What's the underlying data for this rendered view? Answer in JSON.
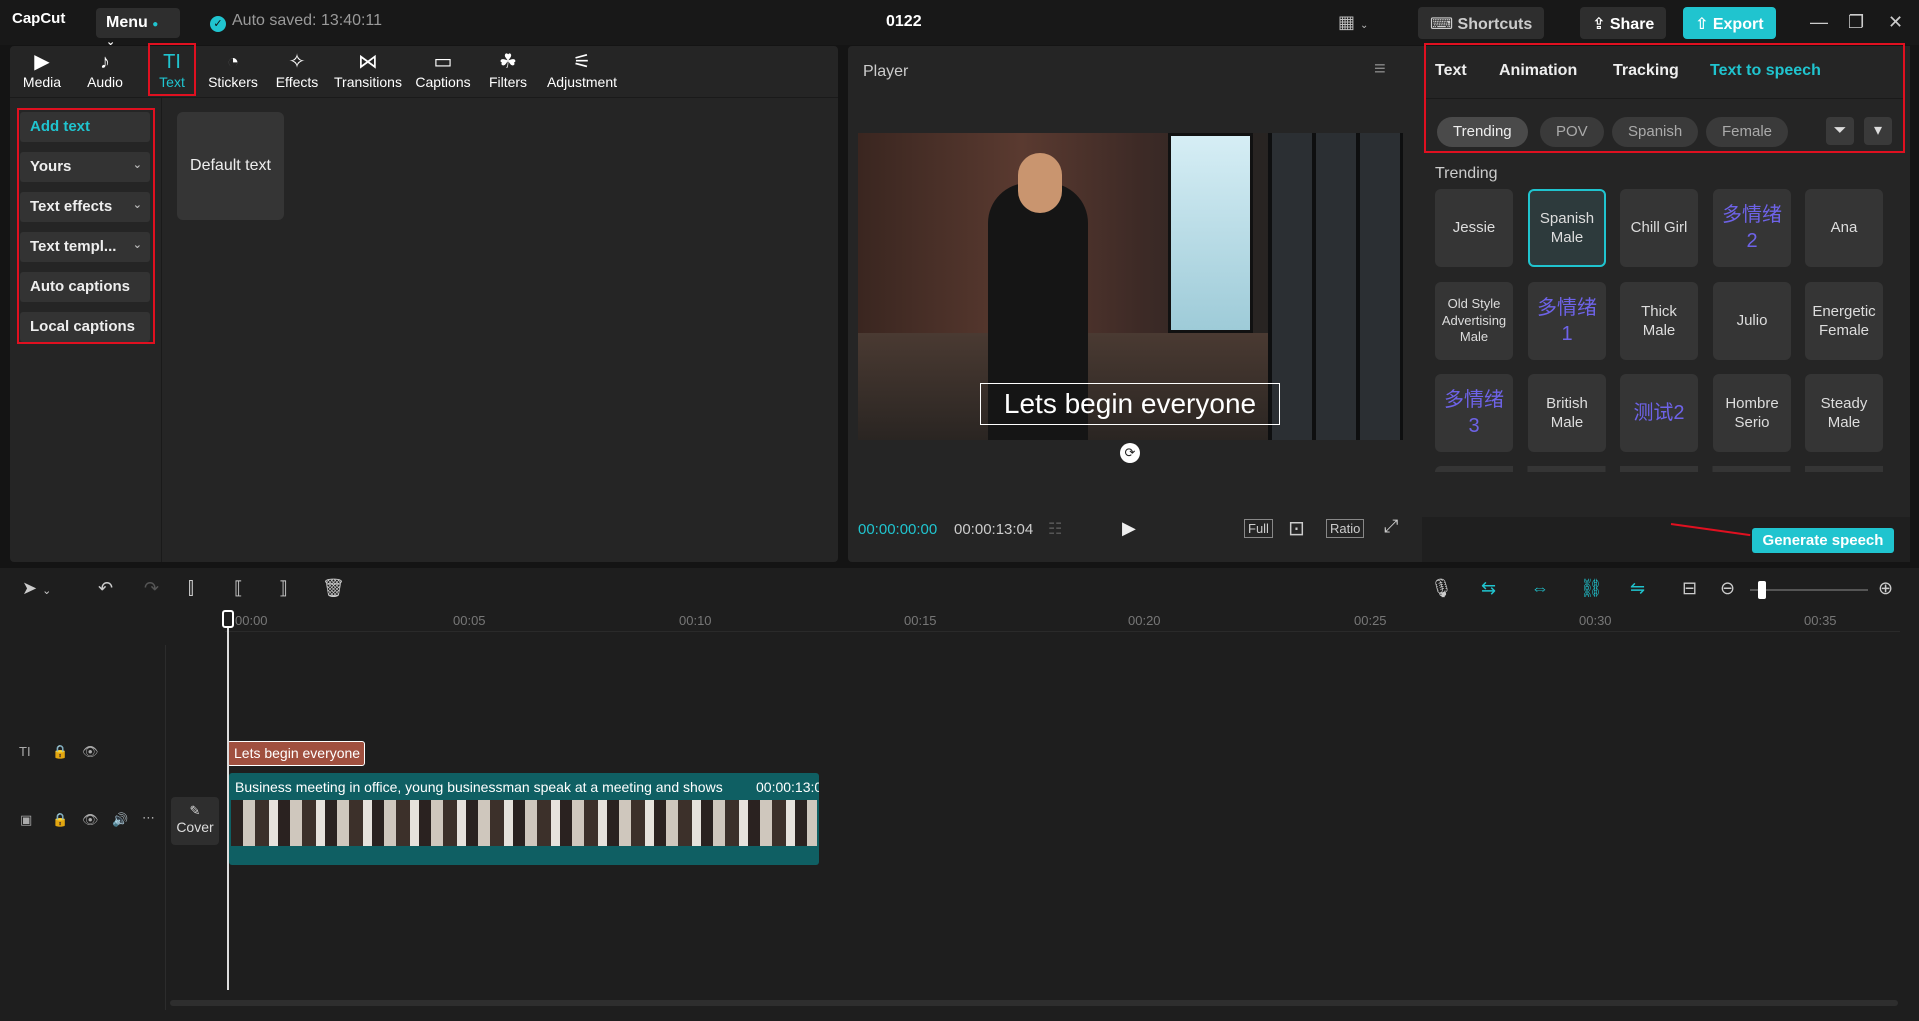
{
  "app": {
    "logo": "CapCut",
    "menu": "Menu",
    "autosave": "Auto saved: 13:40:11",
    "project": "0122"
  },
  "titlebar": {
    "shortcuts": "Shortcuts",
    "share": "Share",
    "export": "Export"
  },
  "media_tabs": [
    {
      "label": "Media",
      "icon": "media-icon"
    },
    {
      "label": "Audio",
      "icon": "audio-icon"
    },
    {
      "label": "Text",
      "icon": "text-icon"
    },
    {
      "label": "Stickers",
      "icon": "stickers-icon"
    },
    {
      "label": "Effects",
      "icon": "effects-icon"
    },
    {
      "label": "Transitions",
      "icon": "transitions-icon"
    },
    {
      "label": "Captions",
      "icon": "captions-icon"
    },
    {
      "label": "Filters",
      "icon": "filters-icon"
    },
    {
      "label": "Adjustment",
      "icon": "adjustment-icon"
    }
  ],
  "sidebar": {
    "items": [
      "Add text",
      "Yours",
      "Text effects",
      "Text templ...",
      "Auto captions",
      "Local captions"
    ]
  },
  "content": {
    "default_text": "Default text"
  },
  "player": {
    "title": "Player",
    "caption": "Lets begin everyone",
    "time_current": "00:00:00:00",
    "time_total": "00:00:13:04",
    "full": "Full",
    "ratio": "Ratio"
  },
  "tts": {
    "tabs": [
      "Text",
      "Animation",
      "Tracking",
      "Text to speech"
    ],
    "filters": [
      "Trending",
      "POV",
      "Spanish",
      "Female"
    ],
    "section": "Trending",
    "voices": [
      "Jessie",
      "Spanish Male",
      "Chill Girl",
      "多情绪2",
      "Ana",
      "Old Style Advertising Male",
      "多情绪1",
      "Thick Male",
      "Julio",
      "Energetic Female",
      "多情绪3",
      "British Male",
      "测试2",
      "Hombre Serio",
      "Steady Male"
    ],
    "generate": "Generate speech"
  },
  "timeline": {
    "ticks": [
      "00:00",
      "00:05",
      "00:10",
      "00:15",
      "00:20",
      "00:25",
      "00:30",
      "00:35"
    ],
    "text_clip": "Lets begin everyone",
    "video_clip": "Business meeting in office, young businessman speak at a meeting and shows",
    "video_duration": "00:00:13:0",
    "cover": "Cover"
  },
  "colors": {
    "accent": "#20c4cf",
    "highlight": "#e01020",
    "text_clip": "#a0503f",
    "video_clip": "#0f5f63"
  }
}
